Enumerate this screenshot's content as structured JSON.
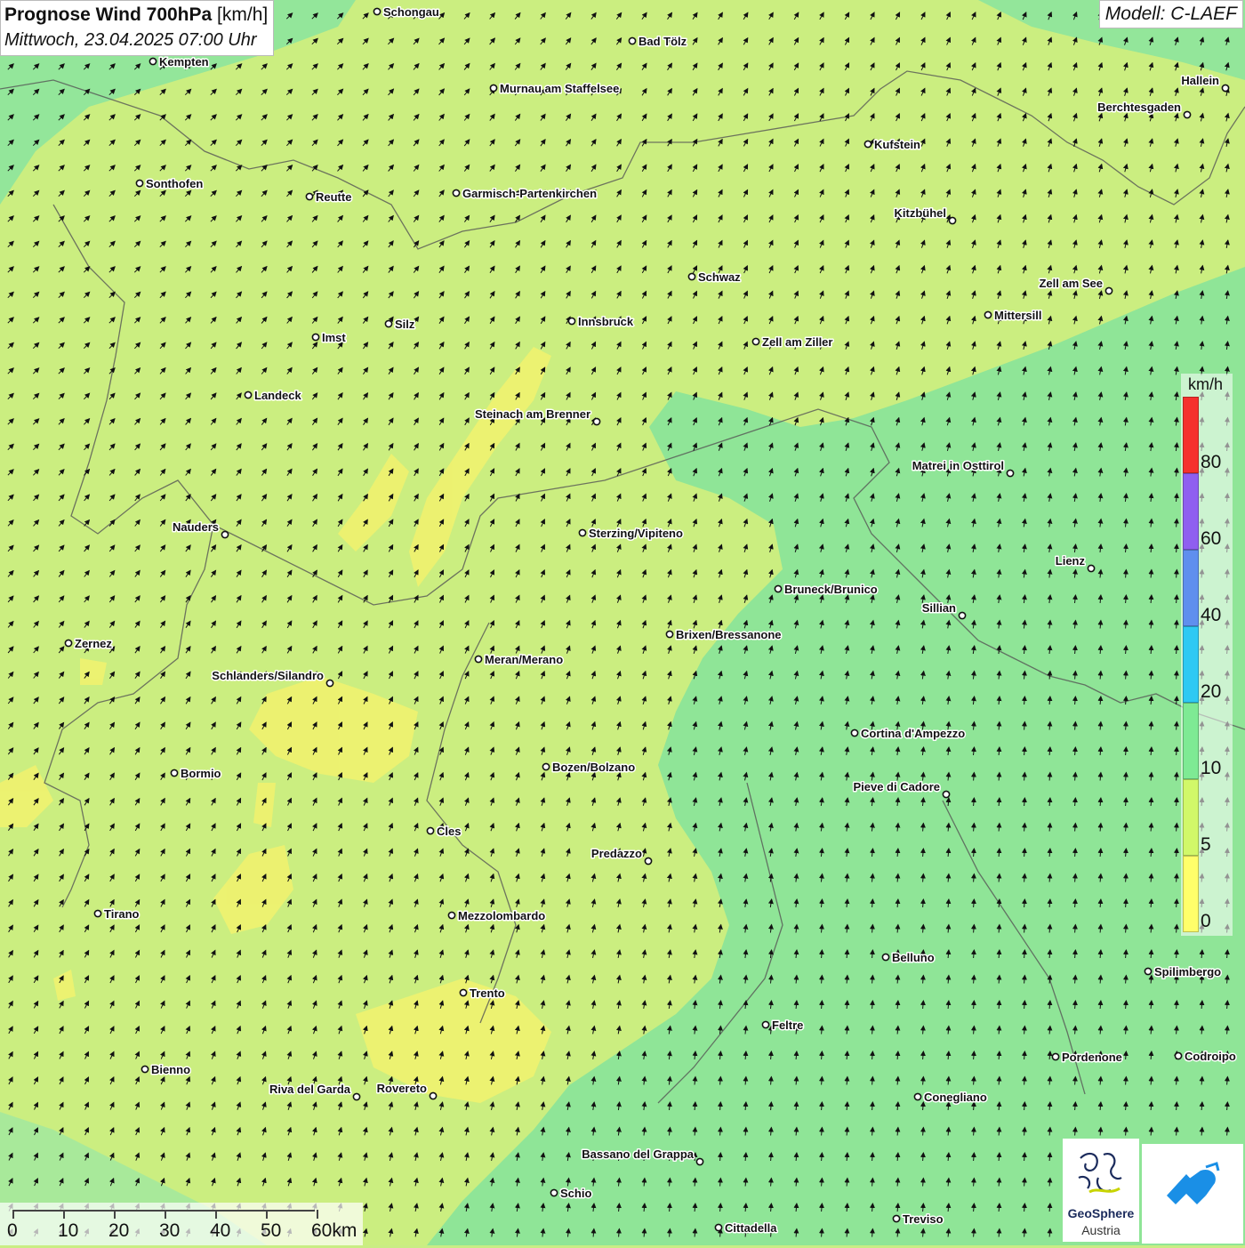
{
  "header": {
    "title_bold": "Prognose Wind 700hPa",
    "title_unit": "[km/h]",
    "datetime": "Mittwoch, 23.04.2025 07:00 Uhr",
    "model": "Modell: C-LAEF"
  },
  "legend": {
    "unit": "km/h",
    "colors": [
      "#ffff6a",
      "#d1f869",
      "#7eea94",
      "#2ec9f3",
      "#5f8fee",
      "#8f5ff0",
      "#f5312d"
    ],
    "ticks": [
      "0",
      "5",
      "10",
      "20",
      "40",
      "60",
      "80"
    ]
  },
  "scalebar": {
    "labels": [
      "0",
      "10",
      "20",
      "30",
      "40",
      "50",
      "60km"
    ]
  },
  "logo": {
    "line1": "GeoSphere",
    "line2": "Austria"
  },
  "cities": [
    {
      "name": "Schongau"
    },
    {
      "name": "Bad Tölz"
    },
    {
      "name": "Kempten"
    },
    {
      "name": "Murnau am Staffelsee"
    },
    {
      "name": "Hallein"
    },
    {
      "name": "Berchtesgaden"
    },
    {
      "name": "Kufstein"
    },
    {
      "name": "Sonthofen"
    },
    {
      "name": "Reutte"
    },
    {
      "name": "Garmisch-Partenkirchen"
    },
    {
      "name": "Kitzbühel"
    },
    {
      "name": "Schwaz"
    },
    {
      "name": "Zell am See"
    },
    {
      "name": "Mittersill"
    },
    {
      "name": "Innsbruck"
    },
    {
      "name": "Silz"
    },
    {
      "name": "Imst"
    },
    {
      "name": "Zell am Ziller"
    },
    {
      "name": "Landeck"
    },
    {
      "name": "Steinach am Brenner"
    },
    {
      "name": "Matrei in Osttirol"
    },
    {
      "name": "Nauders"
    },
    {
      "name": "Sterzing/Vipiteno"
    },
    {
      "name": "Lienz"
    },
    {
      "name": "Bruneck/Brunico"
    },
    {
      "name": "Sillian"
    },
    {
      "name": "Brixen/Bressanone"
    },
    {
      "name": "Zernez"
    },
    {
      "name": "Meran/Merano"
    },
    {
      "name": "Schlanders/Silandro"
    },
    {
      "name": "Cortina d'Ampezzo"
    },
    {
      "name": "Bozen/Bolzano"
    },
    {
      "name": "Bormio"
    },
    {
      "name": "Pieve di Cadore"
    },
    {
      "name": "Cles"
    },
    {
      "name": "Predazzo"
    },
    {
      "name": "Tirano"
    },
    {
      "name": "Mezzolombardo"
    },
    {
      "name": "Belluno"
    },
    {
      "name": "Spilimbergo"
    },
    {
      "name": "Trento"
    },
    {
      "name": "Feltre"
    },
    {
      "name": "Pordenone"
    },
    {
      "name": "Codroipo"
    },
    {
      "name": "Bienno"
    },
    {
      "name": "Riva del Garda"
    },
    {
      "name": "Rovereto"
    },
    {
      "name": "Conegliano"
    },
    {
      "name": "Bassano del Grappa"
    },
    {
      "name": "Schio"
    },
    {
      "name": "Treviso"
    },
    {
      "name": "Cittadella"
    }
  ]
}
